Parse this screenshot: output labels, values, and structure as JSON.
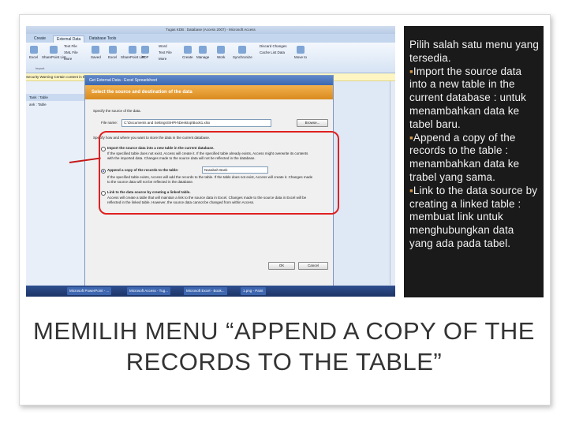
{
  "screenshot": {
    "window_title": "Tugas KDB : Database (Access 2007) - Microsoft Access",
    "tabs": [
      "Create",
      "External Data",
      "Database Tools"
    ],
    "active_tab": "External Data",
    "ribbon": {
      "buttons": [
        "Excel",
        "SharePoint List",
        "Text File",
        "XML File",
        "More",
        "Saved",
        "Excel",
        "SharePoint List",
        "PDF",
        "Word",
        "Text File",
        "More",
        "Create",
        "Manage",
        "Work",
        "Synchronize",
        "Discard Changes",
        "Cache List Data",
        "Move to"
      ],
      "group_label": "Import"
    },
    "message_bar": "Security Warning   Certain content in the database has been disabled",
    "nav": {
      "header": "Tank : Table",
      "item": "ank : Table"
    },
    "dialog": {
      "title": "Get External Data - Excel Spreadsheet",
      "heading": "Select the source and destination of the data",
      "specify_source": "Specify the source of the data.",
      "file_name_label": "File name:",
      "file_name_value": "C:\\Documents and Settings\\SHPH\\Desktop\\Book1.xlsx",
      "browse": "Browse...",
      "specify_how": "Specify how and where you want to store the data in the current database.",
      "options": [
        {
          "label": "Import the source data into a new table in the current database.",
          "desc1": "If the specified table does not exist, Access will create it. If the specified table already exists, Access might overwrite its contents",
          "desc2": "with the imported data. Changes made to the source data will not be reflected in the database."
        },
        {
          "label": "Append a copy of the records to the table:",
          "select_value": "Nasabah Bank",
          "desc1": "If the specified table exists, Access will add the records to the table. If the table does not exist, Access will create it. Changes made",
          "desc2": "to the source data will not be reflected in the database."
        },
        {
          "label": "Link to the data source by creating a linked table.",
          "desc1": "Access will create a table that will maintain a link to the source data in Excel. Changes made to the source data in Excel will be",
          "desc2": "reflected in the linked table. However, the source data cannot be changed from within Access."
        }
      ],
      "ok": "OK",
      "cancel": "Cancel"
    },
    "taskbar": [
      "Microsoft PowerPoint - ...",
      "Microsoft Access - Tug...",
      "Microsoft Excel - Book...",
      "1.png - Paint"
    ]
  },
  "side_panel": {
    "intro": "Pilih salah satu menu yang tersedia.",
    "bullet_char": "▪",
    "items": [
      "Import the source data into a new table in the current database : untuk menambahkan data ke tabel baru.",
      "Append a copy of the records to the table : menambahkan data ke trabel yang sama.",
      "Link to the data source by creating a linked table : membuat link untuk menghubungkan data yang ada pada tabel."
    ]
  },
  "caption": "MEMILIH MENU “APPEND A COPY OF THE RECORDS TO THE TABLE”",
  "colors": {
    "highlight": "#e02020",
    "side_bg": "#1a1a1a",
    "bullet": "#d79b4a"
  }
}
